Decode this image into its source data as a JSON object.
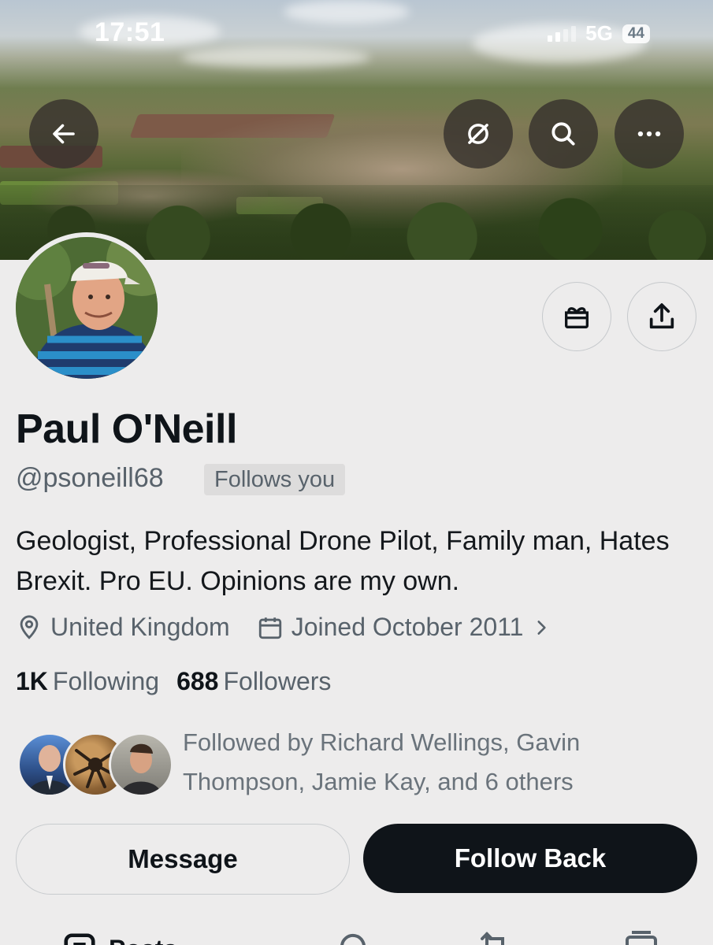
{
  "status_bar": {
    "time": "17:51",
    "network": "5G",
    "battery": "44"
  },
  "header": {
    "back_icon": "arrow-left-icon",
    "actions": [
      "broken-link-icon",
      "search-icon",
      "more-icon"
    ]
  },
  "profile": {
    "name": "Paul O'Neill",
    "handle": "@psoneill68",
    "follows_you_badge": "Follows you",
    "bio": "Geologist, Professional Drone Pilot, Family man, Hates Brexit. Pro EU. Opinions are my own.",
    "location": "United Kingdom",
    "joined": "Joined October 2011",
    "following_count": "1K",
    "following_label": "Following",
    "followers_count": "688",
    "followers_label": "Followers",
    "followed_by": "Followed by Richard Wellings, Gavin Thompson, Jamie Kay, and 6 others"
  },
  "actions": {
    "message_label": "Message",
    "follow_label": "Follow Back"
  },
  "tabs": {
    "posts_label": "Posts"
  },
  "colors": {
    "background": "#edecec",
    "text_primary": "#0f1419",
    "text_secondary": "#58626b",
    "follow_button": "#0f1419"
  }
}
